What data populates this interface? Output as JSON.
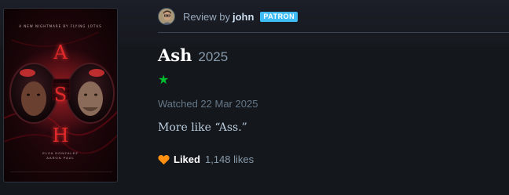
{
  "poster": {
    "tagline": "A NEW NIGHTMARE BY FLYING LOTUS",
    "letters": [
      "A",
      "S",
      "H"
    ],
    "cast_line_1": "ELZA GONZALEZ",
    "cast_line_2": "AARON PAUL",
    "accent": "#e02a2a"
  },
  "reviewer": {
    "prefix": "Review by",
    "username": "john",
    "badge": "PATRON",
    "badge_color": "#40bcf4",
    "avatar_icon": "avatar-photo"
  },
  "film": {
    "title": "Ash",
    "year": "2025"
  },
  "rating": {
    "stars_text": "★",
    "value": 1,
    "max": 5,
    "color": "#00c030"
  },
  "watched": "Watched 22 Mar 2025",
  "review_text": "More like “Ass.”",
  "likes": {
    "label": "Liked",
    "count": "1,148 likes",
    "heart_color": "#ff9010",
    "icon": "heart-icon"
  }
}
